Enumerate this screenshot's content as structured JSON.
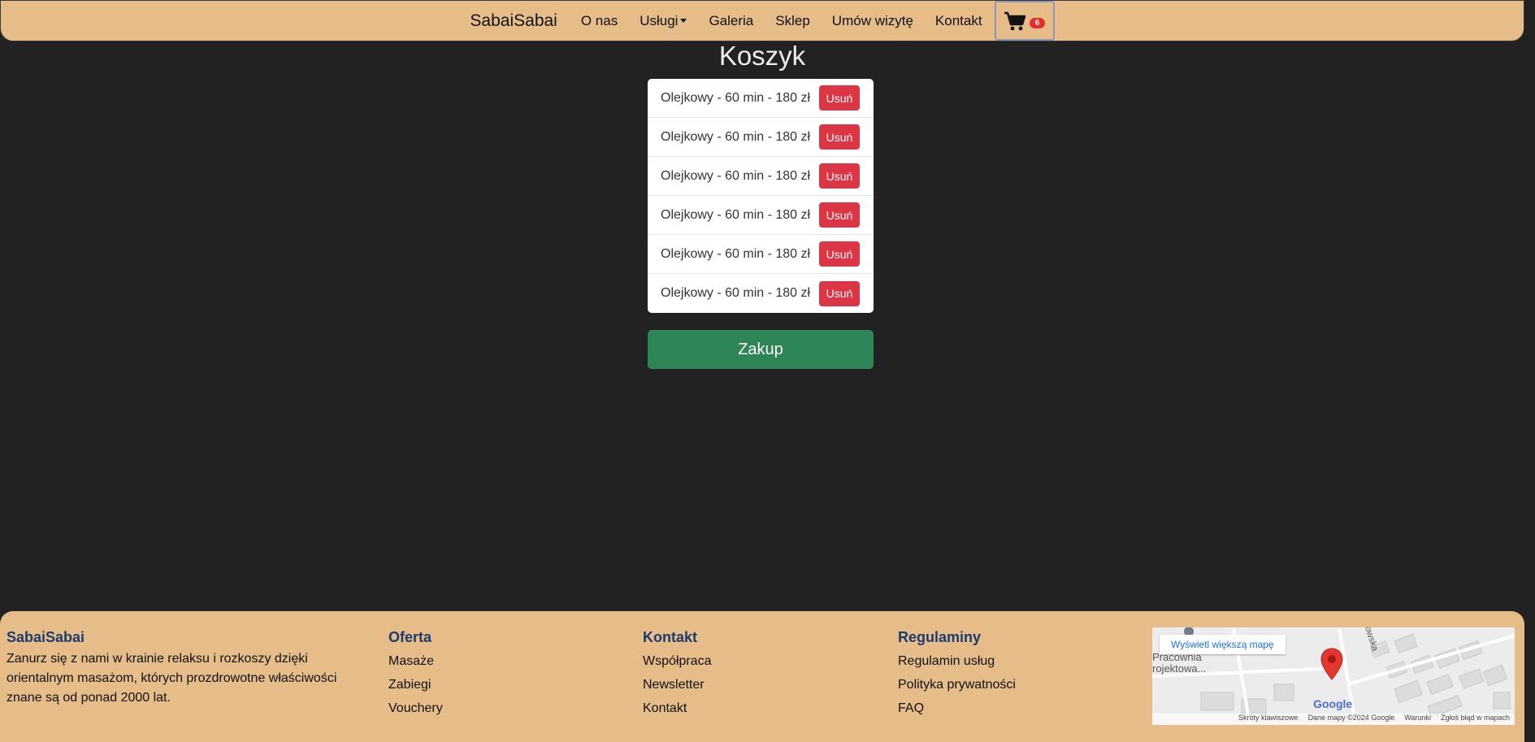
{
  "nav": {
    "brand": "SabaiSabai",
    "items": [
      "O nas",
      "Usługi",
      "Galeria",
      "Sklep",
      "Umów wizytę",
      "Kontakt"
    ],
    "cart_count": "6"
  },
  "main": {
    "title": "Koszyk",
    "cart_items": [
      {
        "label": "Olejkowy - 60 min - 180 zł",
        "remove": "Usuń"
      },
      {
        "label": "Olejkowy - 60 min - 180 zł",
        "remove": "Usuń"
      },
      {
        "label": "Olejkowy - 60 min - 180 zł",
        "remove": "Usuń"
      },
      {
        "label": "Olejkowy - 60 min - 180 zł",
        "remove": "Usuń"
      },
      {
        "label": "Olejkowy - 60 min - 180 zł",
        "remove": "Usuń"
      },
      {
        "label": "Olejkowy - 60 min - 180 zł",
        "remove": "Usuń"
      }
    ],
    "buy_label": "Zakup"
  },
  "footer": {
    "about": {
      "heading": "SabaiSabai",
      "lines": [
        "Zanurz się z nami w krainie relaksu i rozkoszy dzięki",
        "orientalnym masażom, których prozdrowotne właściwości",
        "znane są od ponad 2000 lat."
      ]
    },
    "offer": {
      "heading": "Oferta",
      "links": [
        "Masaże",
        "Zabiegi",
        "Vouchery"
      ]
    },
    "contact": {
      "heading": "Kontakt",
      "links": [
        "Współpraca",
        "Newsletter",
        "Kontakt"
      ]
    },
    "rules": {
      "heading": "Regulaminy",
      "links": [
        "Regulamin usług",
        "Polityka prywatności",
        "FAQ"
      ]
    },
    "map": {
      "view_larger": "Wyświetl większą mapę",
      "place_line1": "Pracownia",
      "place_line2": "rojektowa...",
      "street": "owska",
      "logo": "Google",
      "footer_links": [
        "Skróty klawiszowe",
        "Dane mapy ©2024 Google",
        "Warunki",
        "Zgłoś błąd w mapach"
      ]
    }
  },
  "colors": {
    "nav_bg": "#e6bd88",
    "page_bg": "#222222",
    "remove": "#dc3545",
    "buy": "#2e8555",
    "badge": "#e52d27"
  }
}
